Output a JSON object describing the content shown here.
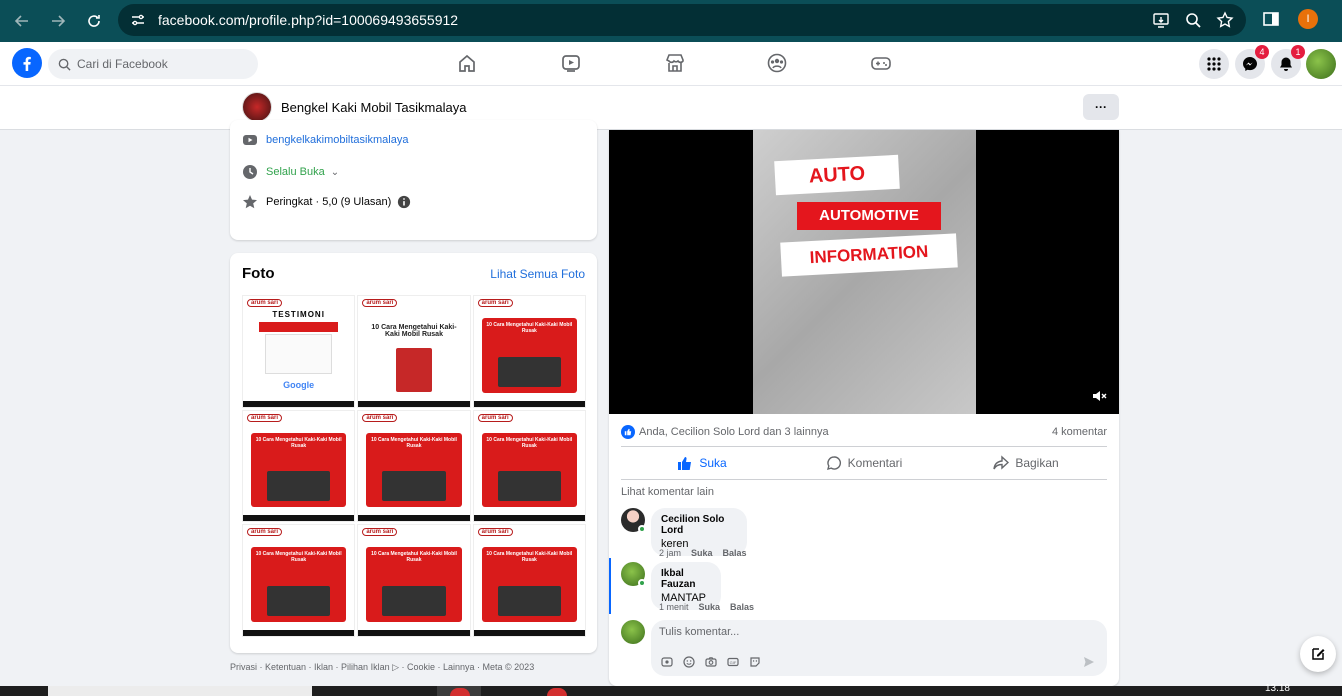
{
  "browser": {
    "url": "facebook.com/profile.php?id=100069493655912",
    "profile_initial": "I",
    "accent": "#0b4e57"
  },
  "fbnav": {
    "search_placeholder": "Cari di Facebook",
    "messenger_badge": "4",
    "notif_badge": "1"
  },
  "page": {
    "name": "Bengkel Kaki Mobil Tasikmalaya",
    "more_label": "···"
  },
  "intro": {
    "youtube": "bengkelkakimobiltasikmalaya",
    "hours": "Selalu Buka",
    "rating": "Peringkat · 5,0 (9 Ulasan)"
  },
  "photos": {
    "title": "Foto",
    "see_all": "Lihat Semua Foto",
    "tiles": [
      {
        "kind": "testimoni",
        "title": "TESTIMONI",
        "brand": "arum sari",
        "footer": "Google"
      },
      {
        "kind": "white",
        "title": "10 Cara Mengetahui Kaki-Kaki Mobil Rusak",
        "brand": "arum sari"
      },
      {
        "kind": "red",
        "title": "10 Cara Mengetahui Kaki-Kaki Mobil Rusak",
        "brand": "arum sari"
      },
      {
        "kind": "red",
        "title": "10 Cara Mengetahui Kaki-Kaki Mobil Rusak",
        "brand": "arum sari"
      },
      {
        "kind": "red",
        "title": "10 Cara Mengetahui Kaki-Kaki Mobil Rusak",
        "brand": "arum sari"
      },
      {
        "kind": "red",
        "title": "10 Cara Mengetahui Kaki-Kaki Mobil Rusak",
        "brand": "arum sari"
      },
      {
        "kind": "red",
        "title": "10 Cara Mengetahui Kaki-Kaki Mobil Rusak",
        "brand": "arum sari"
      },
      {
        "kind": "red",
        "title": "10 Cara Mengetahui Kaki-Kaki Mobil Rusak",
        "brand": "arum sari"
      },
      {
        "kind": "red",
        "title": "10 Cara Mengetahui Kaki-Kaki Mobil Rusak",
        "brand": "arum sari"
      }
    ]
  },
  "footer": "Privasi · Ketentuan · Iklan · Pilihan Iklan ▷ · Cookie · Lainnya · Meta © 2023",
  "post": {
    "video_lines": [
      "AUTO",
      "AUTOMOTIVE",
      "INFORMATION"
    ],
    "reactions": "Anda, Cecilion Solo Lord dan 3 lainnya",
    "comment_count": "4 komentar",
    "like_label": "Suka",
    "comment_label": "Komentari",
    "share_label": "Bagikan",
    "see_more_comments": "Lihat komentar lain",
    "comments": [
      {
        "name": "Cecilion Solo Lord",
        "text": "keren",
        "time": "2 jam",
        "like": "Suka",
        "reply": "Balas"
      },
      {
        "name": "Ikbal Fauzan",
        "text": "MANTAP",
        "time": "1 menit",
        "like": "Suka",
        "reply": "Balas"
      }
    ],
    "write_placeholder": "Tulis komentar..."
  },
  "taskbar": {
    "clock": "13.18"
  }
}
